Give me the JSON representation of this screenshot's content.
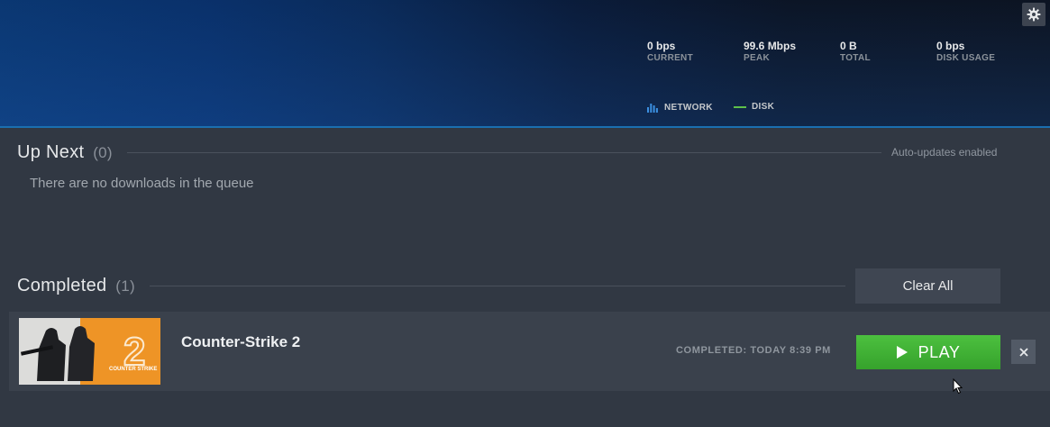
{
  "header": {
    "stats": [
      {
        "value": "0 bps",
        "label": "CURRENT"
      },
      {
        "value": "99.6 Mbps",
        "label": "PEAK"
      },
      {
        "value": "0 B",
        "label": "TOTAL"
      },
      {
        "value": "0 bps",
        "label": "DISK USAGE"
      }
    ],
    "legend": {
      "network": "NETWORK",
      "disk": "DISK"
    },
    "colors": {
      "network": "#3b8fe0",
      "disk": "#5ec04a"
    }
  },
  "up_next": {
    "title": "Up Next",
    "count": "(0)",
    "auto_updates": "Auto-updates enabled",
    "empty_message": "There are no downloads in the queue"
  },
  "completed": {
    "title": "Completed",
    "count": "(1)",
    "clear_all": "Clear All",
    "items": [
      {
        "name": "Counter-Strike 2",
        "status": "COMPLETED: TODAY 8:39 PM",
        "play_label": "PLAY",
        "thumb_text": "COUNTER STRIKE"
      }
    ]
  },
  "icons": [
    "gear-icon",
    "network-bars-icon",
    "disk-line-icon",
    "play-icon",
    "close-icon",
    "mouse-cursor-icon"
  ]
}
